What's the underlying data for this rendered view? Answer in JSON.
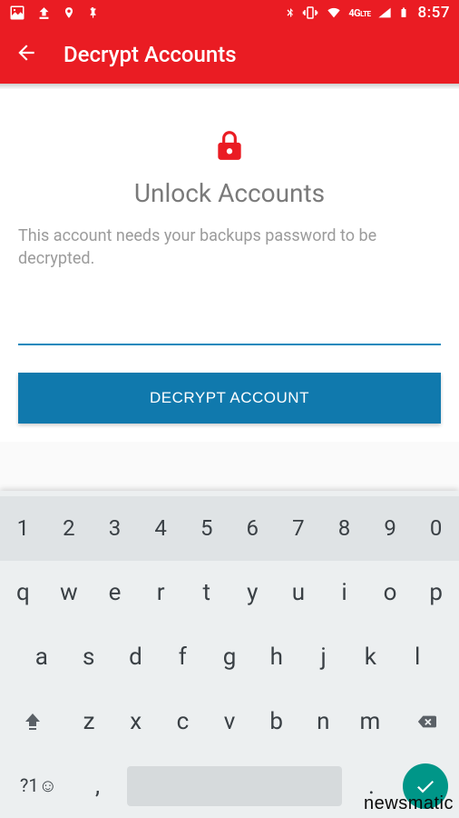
{
  "status": {
    "time": "8:57",
    "network_label": "4G"
  },
  "appbar": {
    "title": "Decrypt Accounts"
  },
  "main": {
    "heading": "Unlock Accounts",
    "subtext": "This account needs your backups password to be decrypted.",
    "password_value": "",
    "button_label": "DECRYPT ACCOUNT"
  },
  "keyboard": {
    "row1": [
      "1",
      "2",
      "3",
      "4",
      "5",
      "6",
      "7",
      "8",
      "9",
      "0"
    ],
    "row2": [
      "q",
      "w",
      "e",
      "r",
      "t",
      "y",
      "u",
      "i",
      "o",
      "p"
    ],
    "row3": [
      "a",
      "s",
      "d",
      "f",
      "g",
      "h",
      "j",
      "k",
      "l"
    ],
    "row4": [
      "z",
      "x",
      "c",
      "v",
      "b",
      "n",
      "m"
    ],
    "sym": "?1☺",
    "comma": ",",
    "dot": "."
  },
  "watermark": "newsmatic"
}
